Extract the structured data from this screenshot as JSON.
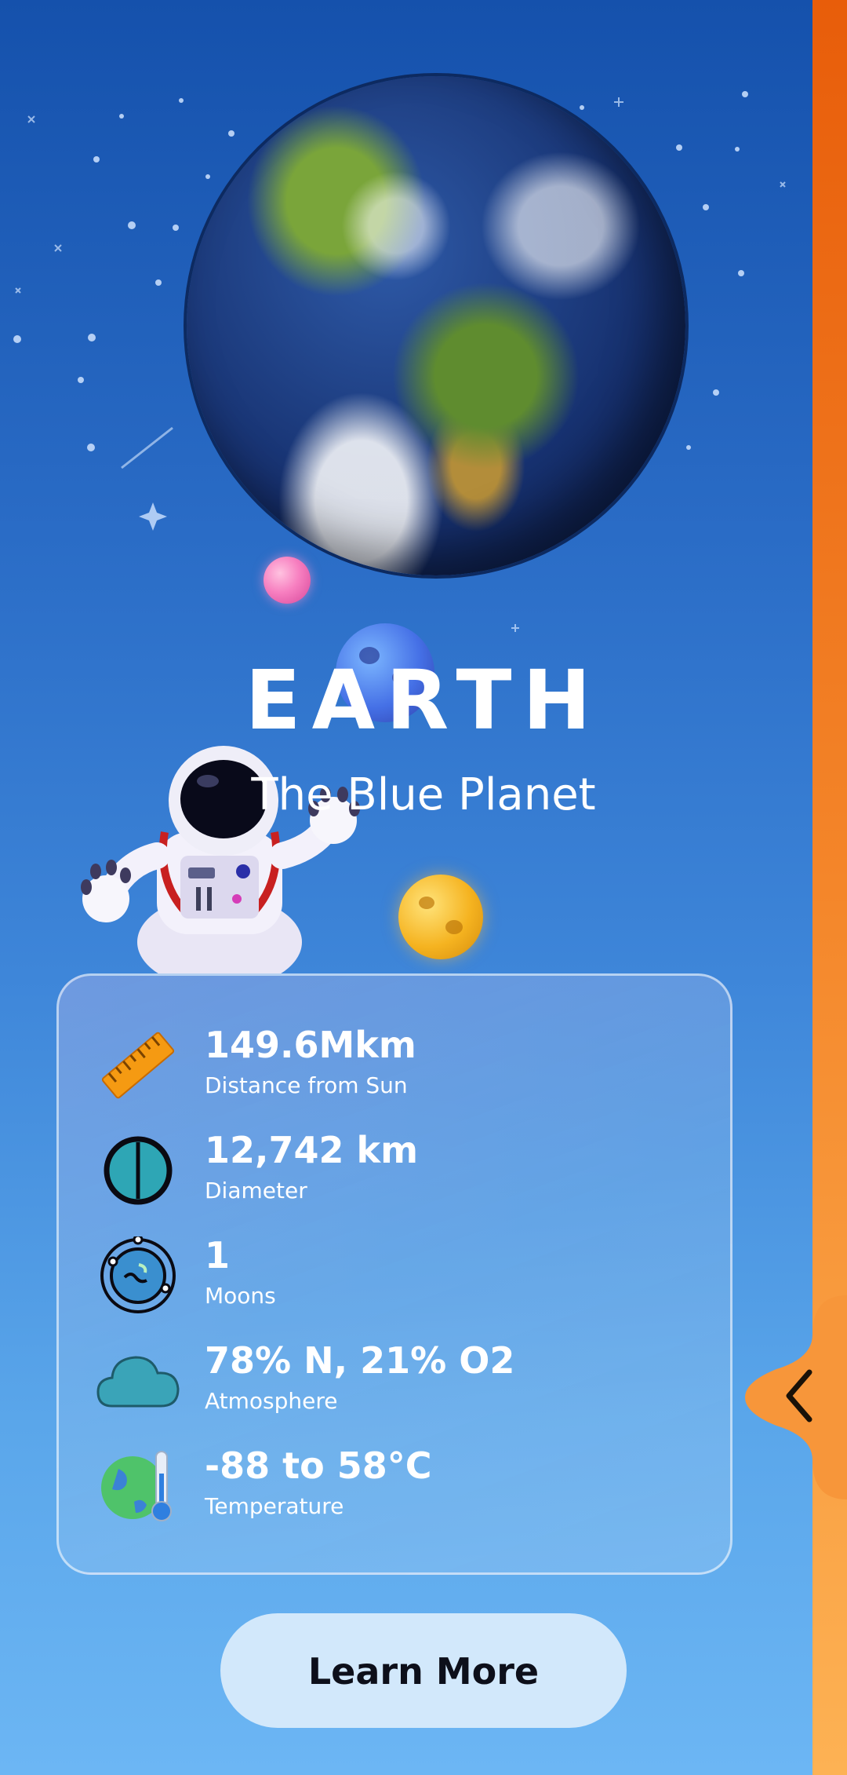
{
  "planet": {
    "title": "EARTH",
    "subtitle": "The Blue Planet"
  },
  "stats": [
    {
      "value": "149.6Mkm",
      "label": "Distance from Sun",
      "icon": "ruler-icon"
    },
    {
      "value": "12,742 km",
      "label": "Diameter",
      "icon": "diameter-icon"
    },
    {
      "value": "1",
      "label": "Moons",
      "icon": "moon-orbit-icon"
    },
    {
      "value": "78% N, 21% O2",
      "label": "Atmosphere",
      "icon": "cloud-icon"
    },
    {
      "value": "-88 to 58°C",
      "label": "Temperature",
      "icon": "thermometer-globe-icon"
    }
  ],
  "actions": {
    "learn_more_label": "Learn More"
  },
  "colors": {
    "background_top": "#1551ac",
    "background_bottom": "#6cb6f4",
    "accent_orange": "#f4862a",
    "button_bg": "#d2e8fb"
  }
}
